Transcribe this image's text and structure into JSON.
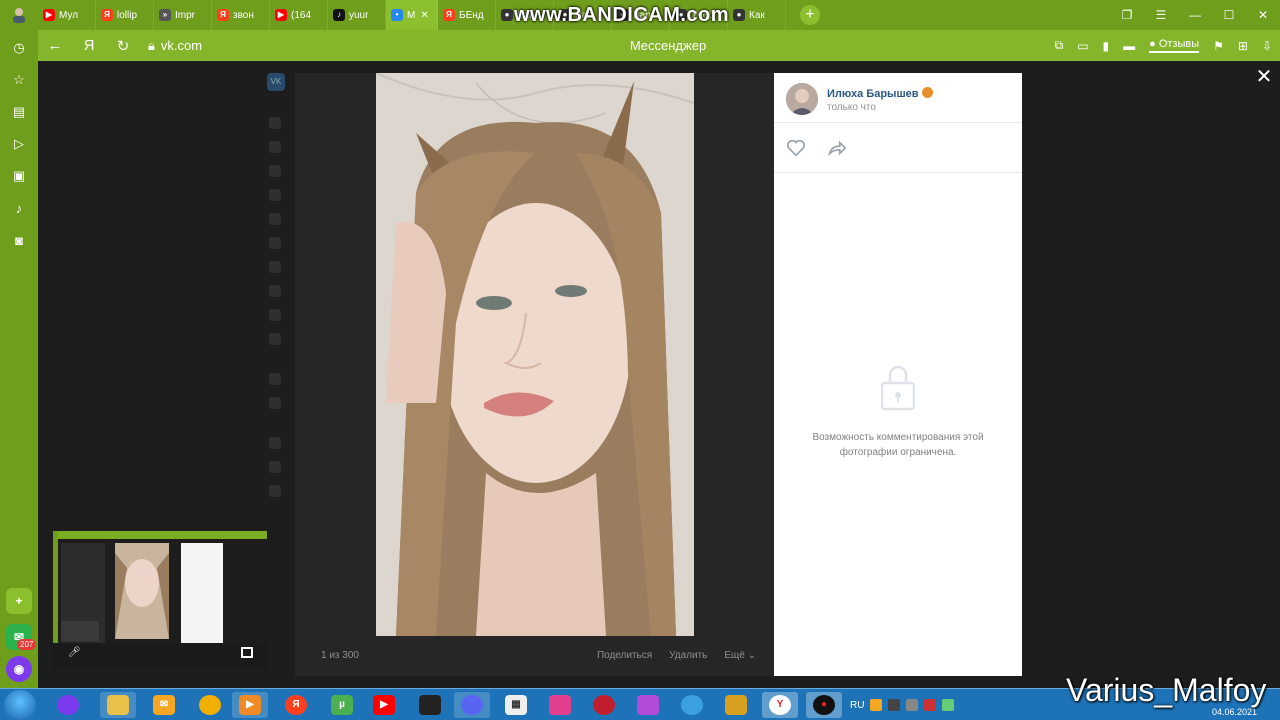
{
  "watermark": "www.BANDICAM.com",
  "tabs": [
    {
      "label": "Мул",
      "color": "#ff0000",
      "glyph": "▶"
    },
    {
      "label": "lollip",
      "color": "#fc3f1d",
      "glyph": "Я"
    },
    {
      "label": "Impr",
      "color": "#555555",
      "glyph": "»"
    },
    {
      "label": "звон",
      "color": "#fc3f1d",
      "glyph": "Я"
    },
    {
      "label": "(164",
      "color": "#ff0000",
      "glyph": "▶"
    },
    {
      "label": "yuur",
      "color": "#111111",
      "glyph": "♪"
    },
    {
      "label": "М",
      "color": "#2688eb",
      "glyph": "•",
      "active": true
    },
    {
      "label": "БЕнд",
      "color": "#fc3f1d",
      "glyph": "Я"
    },
    {
      "label": "Ban",
      "color": "#333333",
      "glyph": "●"
    },
    {
      "label": "Ban",
      "color": "#333333",
      "glyph": "●"
    },
    {
      "label": "Ban",
      "color": "#333333",
      "glyph": "●"
    },
    {
      "label": "Учеб",
      "color": "#333333",
      "glyph": "●"
    },
    {
      "label": "Как",
      "color": "#333333",
      "glyph": "●"
    }
  ],
  "address": {
    "url": "vk.com",
    "title": "Мессенджер",
    "feedback": "Отзывы"
  },
  "viewer": {
    "counter": "1 из 300",
    "actions": [
      "Поделиться",
      "Удалить",
      "Ещё"
    ]
  },
  "post": {
    "author": "Илюха Барышев",
    "time": "только что",
    "locked_message": "Возможность комментирования этой фотографии ограничена."
  },
  "sidebar": {
    "badge": "207"
  },
  "tray": {
    "lang": "RU",
    "date": "04.06.2021"
  },
  "overlay_name": "Varius_Malfoy",
  "colors": {
    "browser_green": "#6f9d1c",
    "address_green": "#84b52a",
    "vk_link": "#2a5885",
    "taskbar": "#1e73b8"
  },
  "icons": {
    "sidebar": [
      "history-icon",
      "star-icon",
      "collections-icon",
      "play-icon",
      "calendar-icon",
      "bell-icon",
      "camera-icon"
    ],
    "taskbar": [
      "explorer-icon",
      "mail-icon",
      "yandex-icon",
      "utorrent-icon",
      "youtube-icon",
      "discord-icon",
      "bandicam-icon"
    ]
  }
}
